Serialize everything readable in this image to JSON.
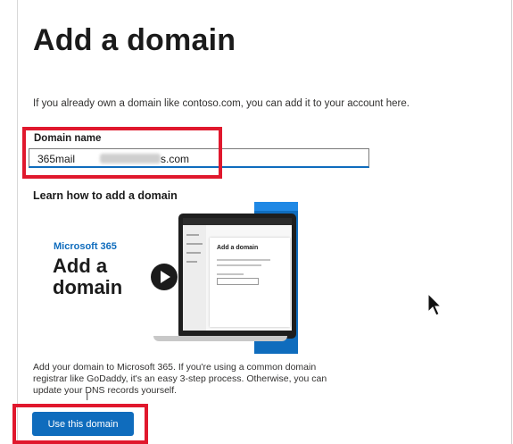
{
  "page": {
    "title": "Add a domain",
    "intro": "If you already own a domain like contoso.com, you can add it to your account here."
  },
  "domain_field": {
    "label": "Domain name",
    "value_prefix": "365mail",
    "value_suffix": "s.com"
  },
  "learn": {
    "heading": "Learn how to add a domain",
    "video_brand": "Microsoft 365",
    "video_title": "Add a domain",
    "video_card_title": "Add a domain",
    "description": "Add your domain to Microsoft 365. If you're using a common domain registrar like GoDaddy, it's an easy 3-step process. Otherwise, you can update your DNS records yourself."
  },
  "actions": {
    "primary_label": "Use this domain"
  },
  "icons": {
    "play": "play-icon",
    "cursor": "mouse-pointer-icon"
  },
  "colors": {
    "accent": "#0f6cbd",
    "highlight": "#e0182d"
  }
}
